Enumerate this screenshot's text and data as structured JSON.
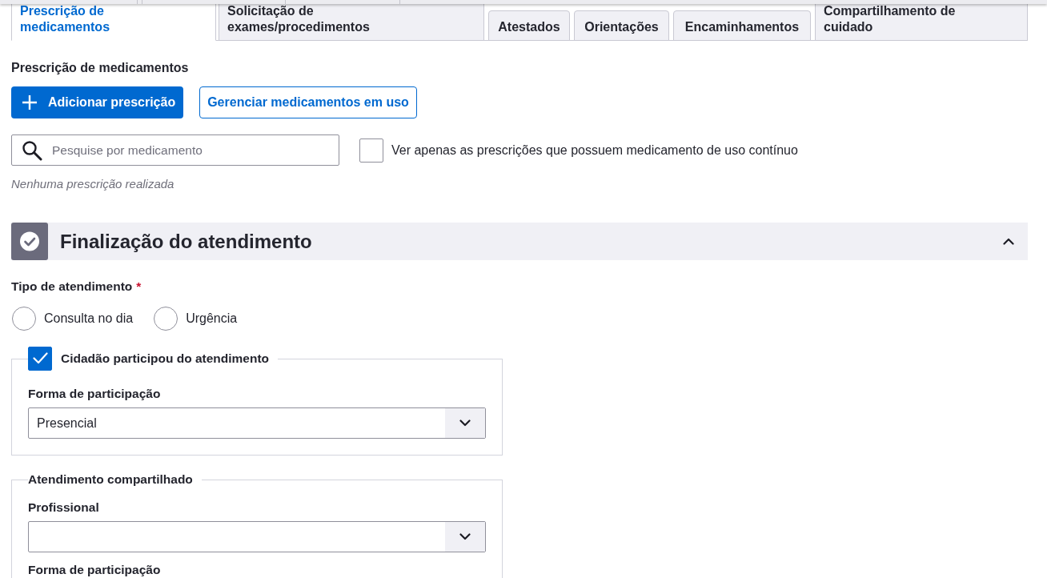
{
  "tabs": [
    {
      "label": "Prescrição de medicamentos",
      "selected": true
    },
    {
      "label": "Solicitação de exames/procedimentos",
      "selected": false
    },
    {
      "label": "Atestados",
      "selected": false
    },
    {
      "label": "Orientações",
      "selected": false
    },
    {
      "label": "Encaminhamentos",
      "selected": false
    },
    {
      "label": "Compartilhamento de cuidado",
      "selected": false
    }
  ],
  "prescription": {
    "title": "Prescrição de medicamentos",
    "add_button": "Adicionar prescrição",
    "manage_button": "Gerenciar medicamentos em uso",
    "search": {
      "placeholder": "Pesquise por medicamento"
    },
    "continuous_filter": {
      "label": "Ver apenas as prescrições que possuem medicamento de uso contínuo",
      "checked": false
    },
    "empty_message": "Nenhuma prescrição realizada"
  },
  "finalization": {
    "title": "Finalização do atendimento",
    "expanded": true,
    "service_type": {
      "label": "Tipo de atendimento",
      "required_mark": "*",
      "options": [
        {
          "label": "Consulta no dia",
          "selected": false
        },
        {
          "label": "Urgência",
          "selected": false
        }
      ]
    },
    "participation": {
      "label": "Cidadão participou do atendimento",
      "checked": true,
      "fields": [
        {
          "kind": "dropdown",
          "label": "Forma de participação",
          "value": "Presencial"
        }
      ]
    },
    "shared_care": {
      "legend": "Atendimento compartilhado",
      "fields": [
        {
          "kind": "dropdown",
          "label": "Profissional"
        },
        {
          "kind": "caption",
          "label": "Forma de participação"
        }
      ]
    }
  }
}
